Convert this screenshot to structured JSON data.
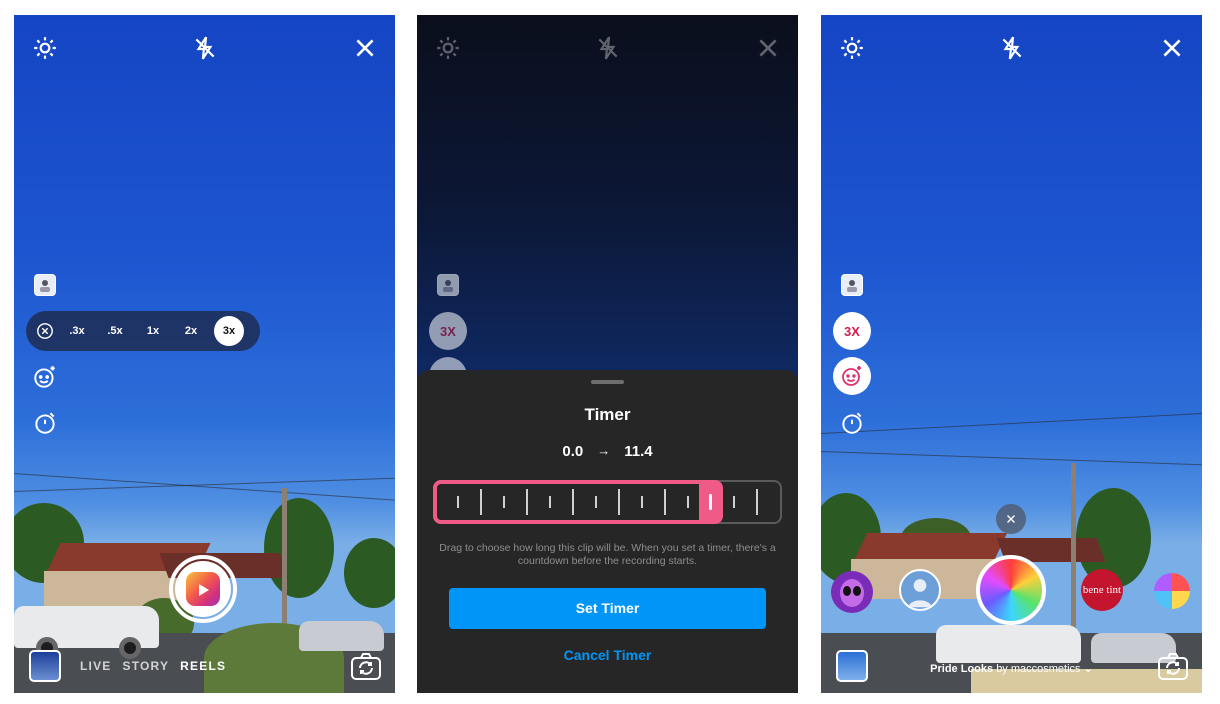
{
  "panel1": {
    "speed_options": [
      ".3x",
      ".5x",
      "1x",
      "2x",
      "3x"
    ],
    "speed_selected": "3x",
    "modes": [
      "LIVE",
      "STORY",
      "REELS"
    ],
    "active_mode": "REELS"
  },
  "panel2": {
    "speed_badge": "3X",
    "timer": {
      "title": "Timer",
      "start": "0.0",
      "arrow": "→",
      "end": "11.4",
      "help_text": "Drag to choose how long this clip will be. When you set a timer, there's a countdown before the recording starts.",
      "set_label": "Set Timer",
      "cancel_label": "Cancel Timer",
      "accent_color": "#ef5b86",
      "button_color": "#0095f6"
    }
  },
  "panel3": {
    "speed_badge": "3X",
    "effect_brand": "bene tint",
    "effect_name": "Pride Looks",
    "effect_by": "by maccosmetics",
    "effect_chevron": "⌄"
  },
  "icons": {
    "settings": "gear-icon",
    "flash": "flash-off-icon",
    "close": "close-icon",
    "effects": "sparkle-face-icon",
    "timer": "timer-icon",
    "flip": "camera-flip-icon"
  }
}
